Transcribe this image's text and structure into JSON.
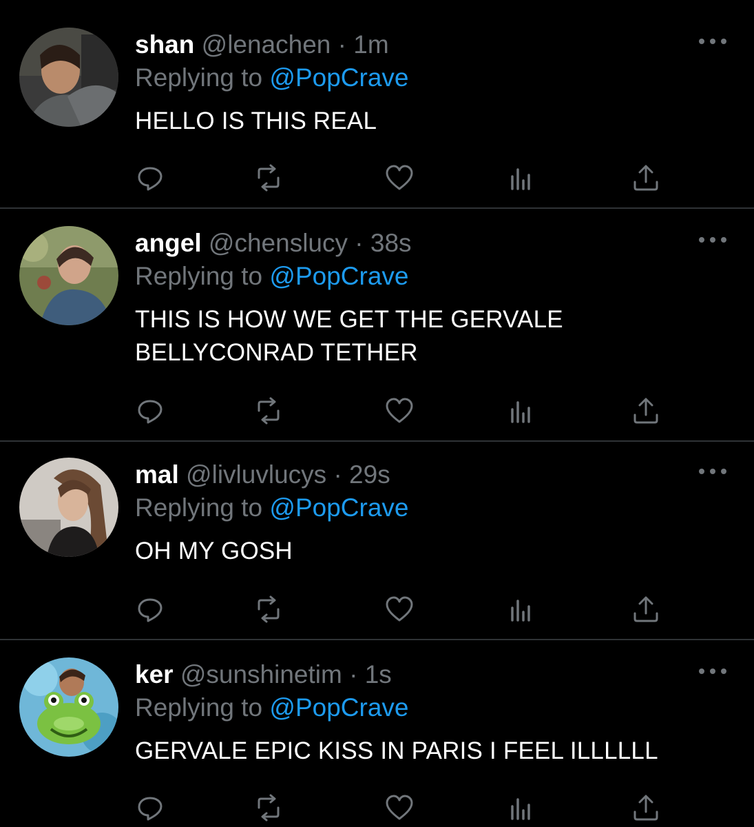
{
  "colors": {
    "background": "#000000",
    "divider": "#2f3336",
    "secondary_text": "#71767b",
    "accent": "#1d9bf0",
    "primary_text": "#ffffff"
  },
  "replies": [
    {
      "display_name": "shan",
      "handle": "@lenachen",
      "separator": "·",
      "time": "1m",
      "reply_prefix": "Replying to",
      "reply_target": "@PopCrave",
      "text": "HELLO IS THIS REAL",
      "avatar": "avatar-photo"
    },
    {
      "display_name": "angel",
      "handle": "@chenslucy",
      "separator": "·",
      "time": "38s",
      "reply_prefix": "Replying to",
      "reply_target": "@PopCrave",
      "text": "THIS IS HOW WE GET THE GERVALE BELLYCONRAD TETHER",
      "avatar": "avatar-photo"
    },
    {
      "display_name": "mal",
      "handle": "@livluvlucys",
      "separator": "·",
      "time": "29s",
      "reply_prefix": "Replying to",
      "reply_target": "@PopCrave",
      "text": "OH MY GOSH",
      "avatar": "avatar-photo"
    },
    {
      "display_name": "ker",
      "handle": "@sunshinetim",
      "separator": "·",
      "time": "1s",
      "reply_prefix": "Replying to",
      "reply_target": "@PopCrave",
      "text": "GERVALE EPIC KISS IN PARIS I FEEL ILLLLLL",
      "avatar": "avatar-photo"
    }
  ],
  "action_icons": [
    "reply-icon",
    "retweet-icon",
    "like-icon",
    "views-icon",
    "share-icon"
  ]
}
